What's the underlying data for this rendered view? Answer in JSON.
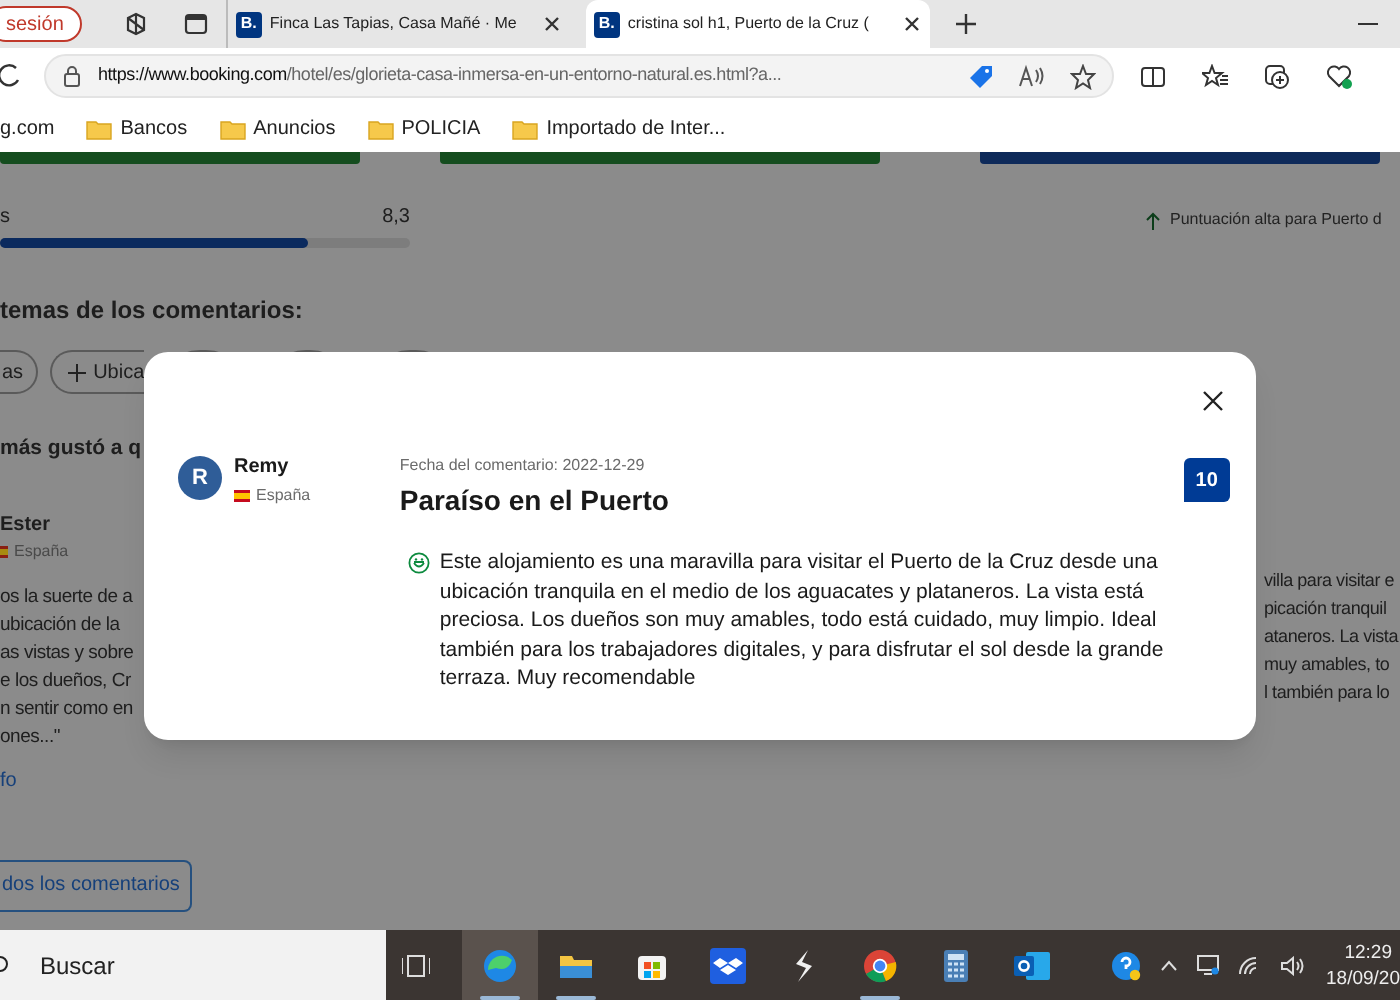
{
  "browser": {
    "profile_button": "sesión",
    "tabs": [
      {
        "favicon": "B.",
        "title": "Finca Las Tapias, Casa Mañé · Me",
        "selected": false
      },
      {
        "favicon": "B.",
        "title": "cristina sol h1, Puerto de la Cruz (",
        "selected": true
      }
    ],
    "url_host": "https://www.booking.com",
    "url_path": "/hotel/es/glorieta-casa-inmersa-en-un-entorno-natural.es.html?a...",
    "bookmarks": [
      {
        "label": "g.com",
        "kind": "site"
      },
      {
        "label": "Bancos",
        "kind": "folder"
      },
      {
        "label": "Anuncios",
        "kind": "folder"
      },
      {
        "label": "POLICIA",
        "kind": "folder"
      },
      {
        "label": "Importado de Inter...",
        "kind": "folder"
      }
    ]
  },
  "page": {
    "score_label": "s",
    "score": "8,3",
    "score_meter": {
      "level": 0.75
    },
    "high_score_note": "Puntuación alta para Puerto d",
    "topics_heading": "temas de los comentarios:",
    "topic_chips": [
      {
        "label": "as",
        "kind": "plain"
      },
      {
        "label": "Ubica",
        "kind": "add"
      }
    ],
    "liked_heading": "más gustó a q",
    "reviewer": {
      "name": "Ester",
      "country": "España"
    },
    "review_lines": [
      "os la suerte de a",
      "ubicación de la",
      "as vistas y sobre",
      "e los dueños, Cr",
      "n sentir como en",
      "ones...\""
    ],
    "more_link": "fo",
    "all_reviews_button": "dos los comentarios",
    "right_review_lines": [
      "villa para visitar e",
      "picación tranquil",
      "ataneros. La vista",
      "muy amables, to",
      "l también para lo"
    ]
  },
  "modal": {
    "reviewer_initial": "R",
    "reviewer_name": "Remy",
    "country": "España",
    "date": "Fecha del comentario: 2022-12-29",
    "title": "Paraíso en el Puerto",
    "score": "10",
    "text": "Este alojamiento es una maravilla para visitar el Puerto de la Cruz desde una ubicación tranquila en el medio de los aguacates y plataneros. La vista está preciosa. Los dueños son muy amables, todo está cuidado, muy limpio. Ideal también para los trabajadores digitales, y para disfrutar el sol desde la grande terraza. Muy recomendable"
  },
  "taskbar": {
    "search_placeholder": "Buscar",
    "time": "12:29",
    "date": "18/09/20",
    "apps": [
      {
        "kind": "edge",
        "running": true
      },
      {
        "kind": "files",
        "running": true
      },
      {
        "kind": "store",
        "running": false
      },
      {
        "kind": "dropbox",
        "running": false
      },
      {
        "kind": "bolt",
        "running": false
      },
      {
        "kind": "chrome",
        "running": true
      },
      {
        "kind": "calculator",
        "running": false
      },
      {
        "kind": "outlook",
        "running": false
      }
    ]
  }
}
